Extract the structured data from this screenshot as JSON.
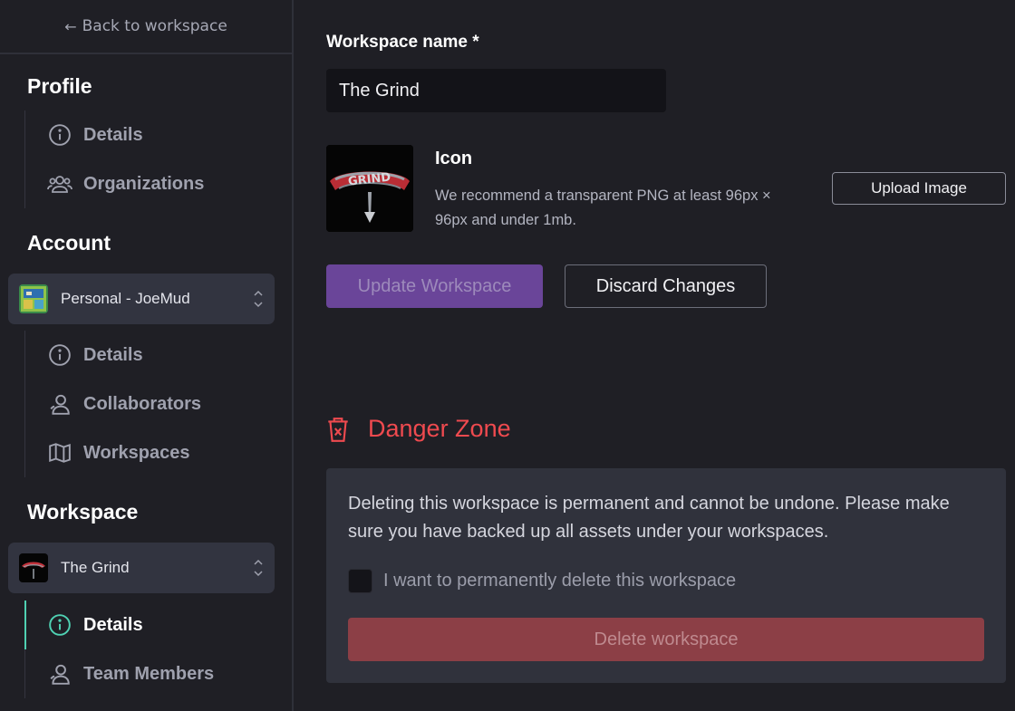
{
  "sidebar": {
    "back_label": "Back to workspace",
    "profile": {
      "title": "Profile",
      "items": [
        {
          "label": "Details",
          "icon": "info-icon"
        },
        {
          "label": "Organizations",
          "icon": "users-icon"
        }
      ]
    },
    "account": {
      "title": "Account",
      "selector_label": "Personal - JoeMud",
      "items": [
        {
          "label": "Details",
          "icon": "info-icon"
        },
        {
          "label": "Collaborators",
          "icon": "user-icon"
        },
        {
          "label": "Workspaces",
          "icon": "map-icon"
        }
      ]
    },
    "workspace": {
      "title": "Workspace",
      "selector_label": "The Grind",
      "items": [
        {
          "label": "Details",
          "icon": "info-icon",
          "active": true
        },
        {
          "label": "Team Members",
          "icon": "user-icon"
        }
      ]
    }
  },
  "main": {
    "name_label": "Workspace name *",
    "name_value": "The Grind",
    "icon_title": "Icon",
    "icon_description": "We recommend a transparent PNG at least 96px × 96px and under 1mb.",
    "upload_label": "Upload Image",
    "update_label": "Update Workspace",
    "discard_label": "Discard Changes",
    "danger": {
      "title": "Danger Zone",
      "text": "Deleting this workspace is permanent and cannot be undone. Please make sure you have backed up all assets under your workspaces.",
      "checkbox_label": "I want to permanently delete this workspace",
      "checkbox_checked": false,
      "delete_label": "Delete workspace"
    }
  },
  "colors": {
    "accent_active": "#4fd1b3",
    "danger": "#ef4a4f",
    "primary_button": "#6a4599",
    "delete_button": "#8c3f46"
  }
}
